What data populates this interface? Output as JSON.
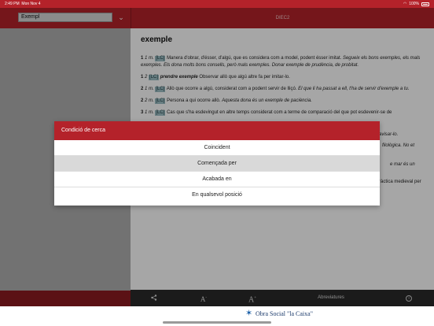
{
  "status_bar": {
    "time": "2:49 PM",
    "date": "Mon Nov 4",
    "battery": "100%"
  },
  "search": {
    "value": "Exempl"
  },
  "header": {
    "title": "DIEC2"
  },
  "entry": {
    "headword": "exemple",
    "senses": [
      {
        "num": "1",
        "sub": "1",
        "pos": "m.",
        "tag": "[LC]",
        "bold": "",
        "text": "Manera d'obrar, d'ésser, d'algú, que es considera com a model, podent ésser imitat.",
        "example": "Segueix els bons exemples, els mals exemples. Els dona molts bons consells, però mals exemples. Donar exemple de prudència, de probitat."
      },
      {
        "num": "1",
        "sub": "2",
        "pos": "",
        "tag": "[LC]",
        "bold": "prendre exemple",
        "text": "Observar allò que algú altre fa per imitar-lo.",
        "example": ""
      },
      {
        "num": "2",
        "sub": "1",
        "pos": "m.",
        "tag": "[LC]",
        "bold": "",
        "text": "Allò que ocorre a algú, considerat com a podent servir de lliçó.",
        "example": "El que li ha passat a ell, t'ha de servir d'exemple a tu."
      },
      {
        "num": "2",
        "sub": "2",
        "pos": "m.",
        "tag": "[LC]",
        "bold": "",
        "text": "Persona a qui ocorre allò.",
        "example": "Aquesta dona és un exemple de paciència."
      },
      {
        "num": "3",
        "sub": "1",
        "pos": "m.",
        "tag": "[LC]",
        "bold": "",
        "text": "Cas que s'ha esdevingut en altre temps considerat com a terme de comparació del que pot esdevenir-se de",
        "example": ""
      }
    ],
    "fragments": [
      "avisar-lo.",
      "filològica. No et",
      "e mar és un",
      "ràctica medieval per"
    ]
  },
  "toolbar": {
    "share_icon": "share-icon",
    "font_smaller": "A",
    "font_larger": "A",
    "abbreviations": "Abreviatures",
    "info_icon": "i"
  },
  "sponsor": {
    "text": "Obra Social \"la Caixa\""
  },
  "modal": {
    "title": "Condició de cerca",
    "options": [
      {
        "label": "Coincident",
        "selected": false
      },
      {
        "label": "Començada per",
        "selected": true
      },
      {
        "label": "Acabada en",
        "selected": false
      },
      {
        "label": "En qualsevol posició",
        "selected": false
      }
    ]
  },
  "colors": {
    "accent": "#b4222a",
    "dark_accent": "#8c1b21",
    "tag_bg": "#9fc0c6",
    "toolbar": "#2a2a2a"
  }
}
